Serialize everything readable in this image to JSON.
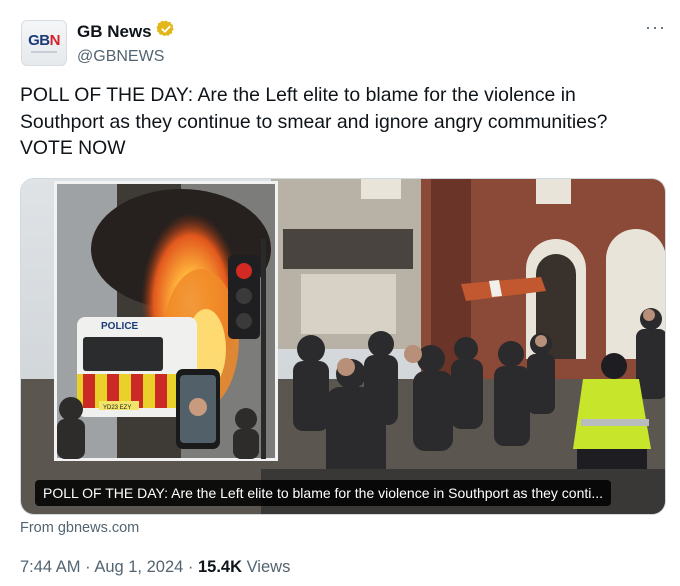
{
  "account": {
    "avatar_text_main": "GB",
    "avatar_text_accent": "N",
    "display_name": "GB News",
    "handle": "@GBNEWS",
    "verified_color": "#e2b719"
  },
  "more_label": "···",
  "tweet": {
    "text": "POLL OF THE DAY: Are the Left elite to blame for the violence in Southport as they continue to smear and ignore angry communities? VOTE NOW"
  },
  "media": {
    "caption": "POLL OF THE DAY: Are the Left elite to blame for the violence in Southport as they conti...",
    "van_text": "POLICE",
    "plate_text": "YD23 EZY"
  },
  "card": {
    "from": "From gbnews.com"
  },
  "meta": {
    "time": "7:44 AM",
    "sep1": " · ",
    "date": "Aug 1, 2024",
    "sep2": " · ",
    "views_count": "15.4K",
    "views_label": " Views"
  }
}
